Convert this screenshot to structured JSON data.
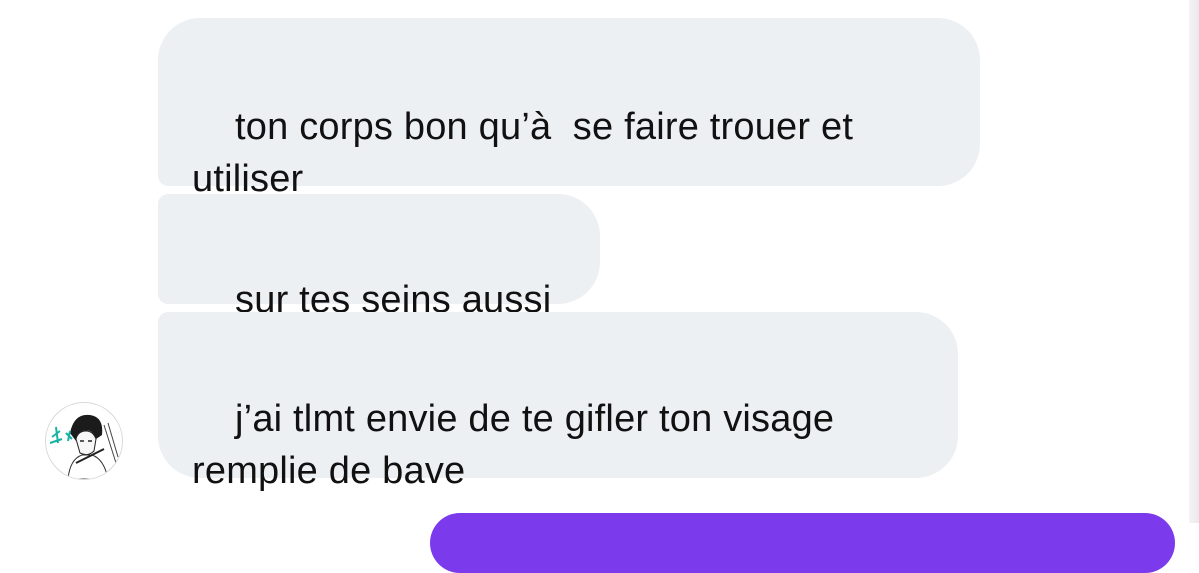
{
  "messages": [
    {
      "sender": "contact",
      "text": "ton corps bon qu’à  se faire trouer et\nutiliser"
    },
    {
      "sender": "contact",
      "text": "sur tes seins aussi"
    },
    {
      "sender": "contact",
      "text": "j’ai tlmt envie de te gifler ton visage\nremplie de bave"
    }
  ],
  "colors": {
    "incoming_bubble": "#edf0f3",
    "outgoing_bubble": "#7c3aed",
    "text": "#111111",
    "background": "#ffffff"
  },
  "avatar": {
    "icon": "manga-character-avatar-icon"
  }
}
